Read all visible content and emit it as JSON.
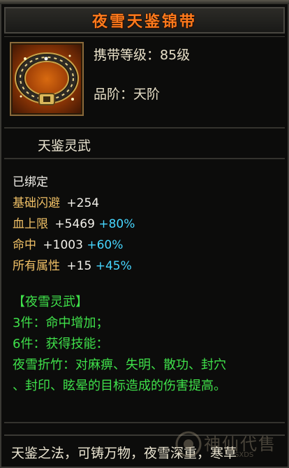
{
  "title": "夜雪天鉴锦带",
  "item": {
    "icon": "belt-icon",
    "level_label": "携带等级：85级",
    "grade_label": "品阶：天阶"
  },
  "subtitle": "天鉴灵武",
  "bound": "已绑定",
  "stats": [
    {
      "name": "基础闪避",
      "value": "+254",
      "bonus": ""
    },
    {
      "name": "血上限",
      "value": "+5469",
      "bonus": "+80%"
    },
    {
      "name": "命中",
      "value": "+1003",
      "bonus": "+60%"
    },
    {
      "name": "所有属性",
      "value": "+15",
      "bonus": "+45%"
    }
  ],
  "set": {
    "name": "【夜雪灵武】",
    "effects": [
      "3件：命中增加；",
      "6件：获得技能：",
      "夜雪折竹：对麻痹、失明、散功、封穴",
      "、封印、眩晕的目标造成的伤害提高。"
    ]
  },
  "flavor": "天鉴之法，可铸万物，夜雪深重，寒草",
  "watermark": {
    "text": "神仙代售",
    "small": "SXDS"
  },
  "colors": {
    "title": "#ff7a1c",
    "stat_name": "#f0c066",
    "stat_bonus": "#46d6ff",
    "set_name": "#ffd845",
    "set_effect": "#3fe04a"
  }
}
